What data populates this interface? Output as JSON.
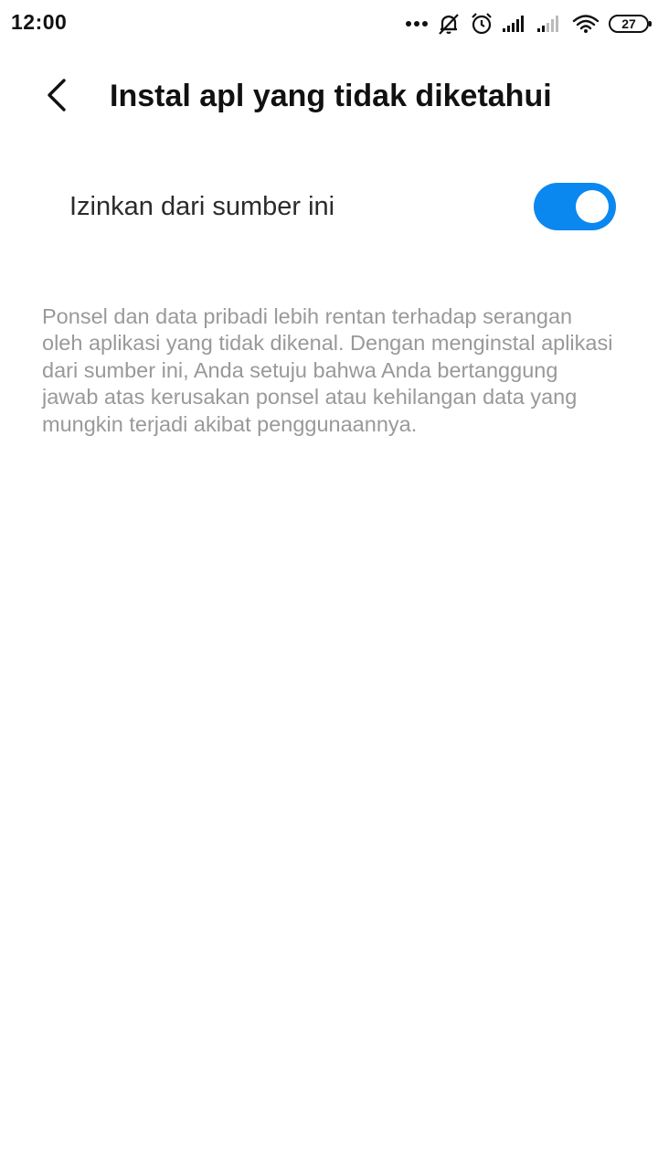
{
  "status_bar": {
    "time": "12:00",
    "battery": "27",
    "icons": [
      "dots-icon",
      "bell-off-icon",
      "alarm-icon",
      "signal-icon",
      "signal-weak-icon",
      "wifi-icon",
      "battery-icon"
    ]
  },
  "header": {
    "back_icon": "chevron-left-icon",
    "title": "Instal apl yang tidak diketahui"
  },
  "setting": {
    "label": "Izinkan dari sumber ini",
    "toggle_on": true,
    "toggle_color": "#0b88f0"
  },
  "description": "Ponsel dan data pribadi lebih rentan terhadap serangan oleh aplikasi yang tidak dikenal. Dengan menginstal aplikasi dari sumber ini, Anda setuju bahwa Anda bertanggung jawab atas kerusakan ponsel atau kehilangan data yang mungkin terjadi akibat penggunaannya."
}
